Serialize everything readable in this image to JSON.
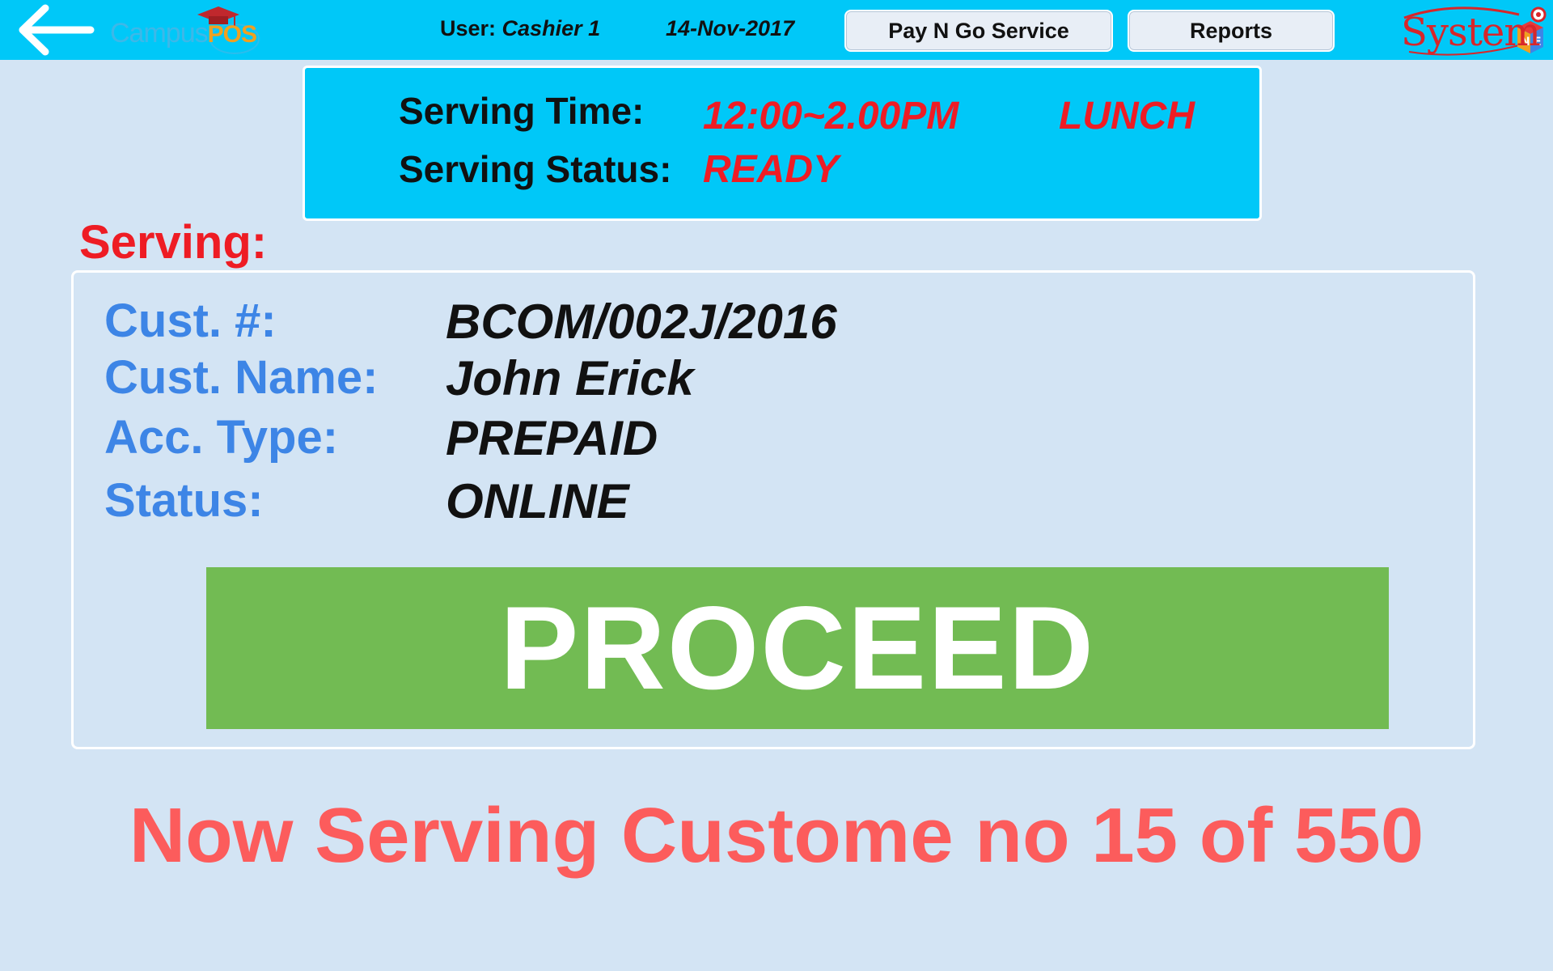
{
  "header": {
    "user_label": "User:",
    "user_name": "Cashier 1",
    "date": "14-Nov-2017",
    "pay_n_go_label": "Pay N Go Service",
    "reports_label": "Reports",
    "campus_logo": {
      "word": "Campus",
      "accent": "POS"
    },
    "system_logo": {
      "word": "System",
      "block_letters": [
        "N",
        "E"
      ]
    }
  },
  "serving_panel": {
    "time_label": "Serving Time:",
    "time_value": "12:00~2.00PM",
    "meal_value": "LUNCH",
    "status_label": "Serving Status:",
    "status_value": "READY"
  },
  "serving_heading": "Serving:",
  "customer": {
    "number_label": "Cust. #:",
    "number_value": "BCOM/002J/2016",
    "name_label": "Cust. Name:",
    "name_value": "John Erick",
    "account_type_label": "Acc. Type:",
    "account_type_value": "PREPAID",
    "status_label": "Status:",
    "status_value": "ONLINE"
  },
  "proceed_label": "PROCEED",
  "now_serving": "Now Serving Custome no 15 of 550",
  "colors": {
    "topbar": "#00c8f8",
    "background": "#d3e4f4",
    "alert_red": "#ee1c24",
    "label_blue": "#3d85e6",
    "proceed_green": "#72bb53",
    "banner_red": "#fc5c5c"
  },
  "icons": {
    "back": "back-arrow-icon"
  }
}
